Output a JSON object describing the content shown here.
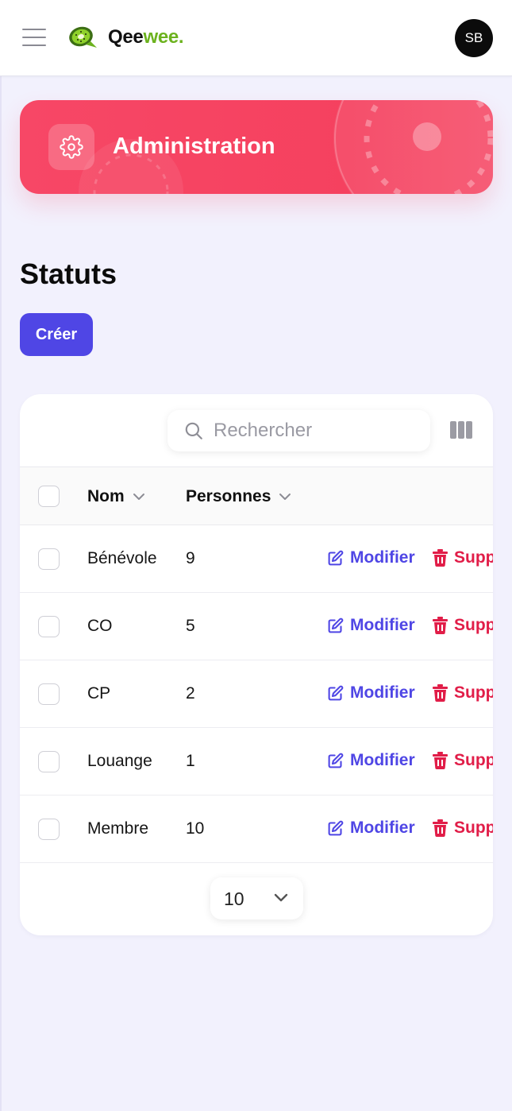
{
  "header": {
    "logo_text_a": "Qee",
    "logo_text_b": "wee.",
    "avatar_initials": "SB",
    "brand_green": "#6cb21e"
  },
  "banner": {
    "title": "Administration",
    "color": "#f5415f"
  },
  "page": {
    "title": "Statuts",
    "create_label": "Créer",
    "accent": "#4f46e5"
  },
  "search": {
    "placeholder": "Rechercher",
    "value": ""
  },
  "table": {
    "columns": [
      {
        "label": "Nom",
        "sortable": true
      },
      {
        "label": "Personnes",
        "sortable": true
      }
    ],
    "edit_label": "Modifier",
    "delete_label": "Supprimer",
    "rows": [
      {
        "name": "Bénévole",
        "count": "9"
      },
      {
        "name": "CO",
        "count": "5"
      },
      {
        "name": "CP",
        "count": "2"
      },
      {
        "name": "Louange",
        "count": "1"
      },
      {
        "name": "Membre",
        "count": "10"
      }
    ]
  },
  "pagination": {
    "per_page": "10"
  }
}
